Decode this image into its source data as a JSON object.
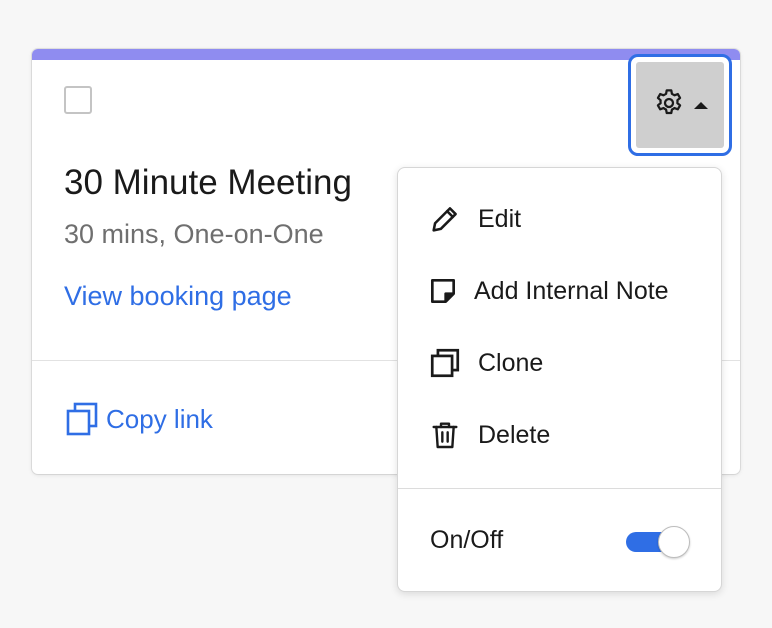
{
  "colors": {
    "card_accent": "#8f8cf0",
    "link": "#2f6ee5",
    "focus_ring": "#2f6ee5",
    "toggle_on": "#2f6ee5"
  },
  "event_card": {
    "title": "30 Minute Meeting",
    "subtitle": "30 mins, One-on-One",
    "view_booking_label": "View booking page",
    "copy_link_label": "Copy link",
    "checkbox_checked": false,
    "settings_icon": "gear-icon",
    "dropdown_caret_icon": "caret-up-icon"
  },
  "settings_menu": {
    "items": [
      {
        "label": "Edit",
        "icon": "pencil-icon"
      },
      {
        "label": "Add Internal Note",
        "icon": "note-icon"
      },
      {
        "label": "Clone",
        "icon": "clone-icon"
      },
      {
        "label": "Delete",
        "icon": "trash-icon"
      }
    ],
    "toggle": {
      "label": "On/Off",
      "on": true
    }
  }
}
